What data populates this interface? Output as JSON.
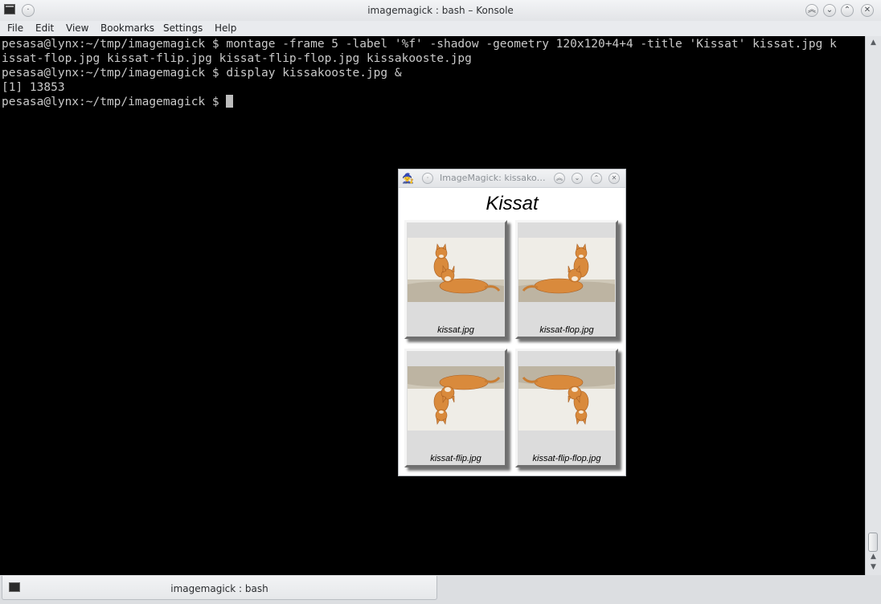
{
  "window": {
    "title": "imagemagick : bash – Konsole",
    "app_icon": "terminal-icon",
    "buttons": [
      "menu-icon",
      "keep-above-icon",
      "minimize-icon",
      "maximize-icon",
      "close-icon"
    ]
  },
  "menu": {
    "items": [
      "File",
      "Edit",
      "View",
      "Bookmarks",
      "Settings",
      "Help"
    ]
  },
  "terminal": {
    "lines": [
      "pesasa@lynx:~/tmp/imagemagick $ montage -frame 5 -label '%f' -shadow -geometry 120x120+4+4 -title 'Kissat' kissat.jpg k",
      "issat-flop.jpg kissat-flip.jpg kissat-flip-flop.jpg kissakooste.jpg",
      "pesasa@lynx:~/tmp/imagemagick $ display kissakooste.jpg &",
      "[1] 13853",
      "pesasa@lynx:~/tmp/imagemagick $ "
    ]
  },
  "tabs": [
    {
      "label": "imagemagick : bash",
      "icon": "terminal-icon"
    }
  ],
  "im_window": {
    "title": "ImageMagick: kissako…",
    "logo": "imagemagick-logo-icon",
    "heading": "Kissat",
    "tiles": [
      {
        "caption": "kissat.jpg",
        "flip": false,
        "flop": false
      },
      {
        "caption": "kissat-flop.jpg",
        "flip": false,
        "flop": true
      },
      {
        "caption": "kissat-flip.jpg",
        "flip": true,
        "flop": false
      },
      {
        "caption": "kissat-flip-flop.jpg",
        "flip": true,
        "flop": true
      }
    ]
  },
  "colors": {
    "terminal_bg": "#000000",
    "terminal_fg": "#c9c9c9",
    "cat_orange": "#d98a3c"
  }
}
